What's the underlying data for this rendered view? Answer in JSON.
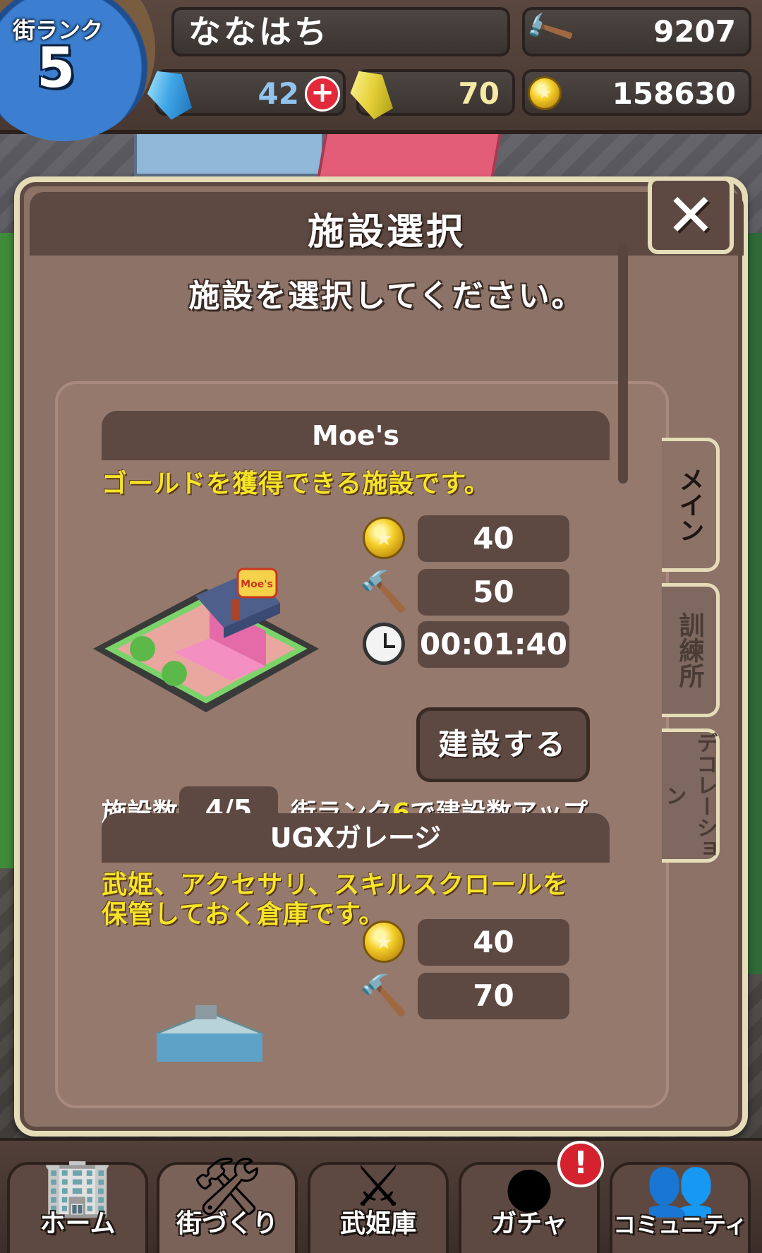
{
  "hud": {
    "rank_label": "街ランク",
    "rank_value": "5",
    "player_name": "ななはち",
    "hammer_count": "9207",
    "blue_gems": "42",
    "plus_symbol": "+",
    "yellow_gems": "70",
    "gold": "158630"
  },
  "dialog": {
    "title": "施設選択",
    "close_symbol": "✕",
    "subtitle": "施設を選択してください。"
  },
  "items": [
    {
      "name": "Moe's",
      "description": "ゴールドを獲得できる施設です。",
      "cost_gold": "40",
      "cost_hammer": "50",
      "build_time": "00:01:40",
      "build_button": "建設する",
      "count_label": "施設数",
      "count_value": "4/5",
      "rank_hint_prefix": "街ランク",
      "rank_hint_number": "6",
      "rank_hint_suffix": "で建設数アップ",
      "building_sign": "Moe's"
    },
    {
      "name": "UGXガレージ",
      "description_line1": "武姫、アクセサリ、スキルスクロールを",
      "description_line2": "保管しておく倉庫です。",
      "cost_gold": "40",
      "cost_hammer": "70"
    }
  ],
  "side_tabs": [
    {
      "label": "メイン",
      "active": true
    },
    {
      "label": "訓練所",
      "active": false
    },
    {
      "label": "デコレーション",
      "active": false
    }
  ],
  "bottom_nav": [
    {
      "label": "ホーム",
      "icon": "building-icon"
    },
    {
      "label": "街づくり",
      "icon": "tools-icon",
      "active": true
    },
    {
      "label": "武姫庫",
      "icon": "weapons-icon"
    },
    {
      "label": "ガチャ",
      "icon": "gacha-icon",
      "alert": "!"
    },
    {
      "label": "コミュニティ",
      "icon": "people-icon"
    }
  ],
  "colors": {
    "panel_brown": "#8c7267",
    "dark_brown": "#5d4942",
    "highlight_yellow": "#f5e428",
    "border_cream": "#e6ddb8"
  }
}
